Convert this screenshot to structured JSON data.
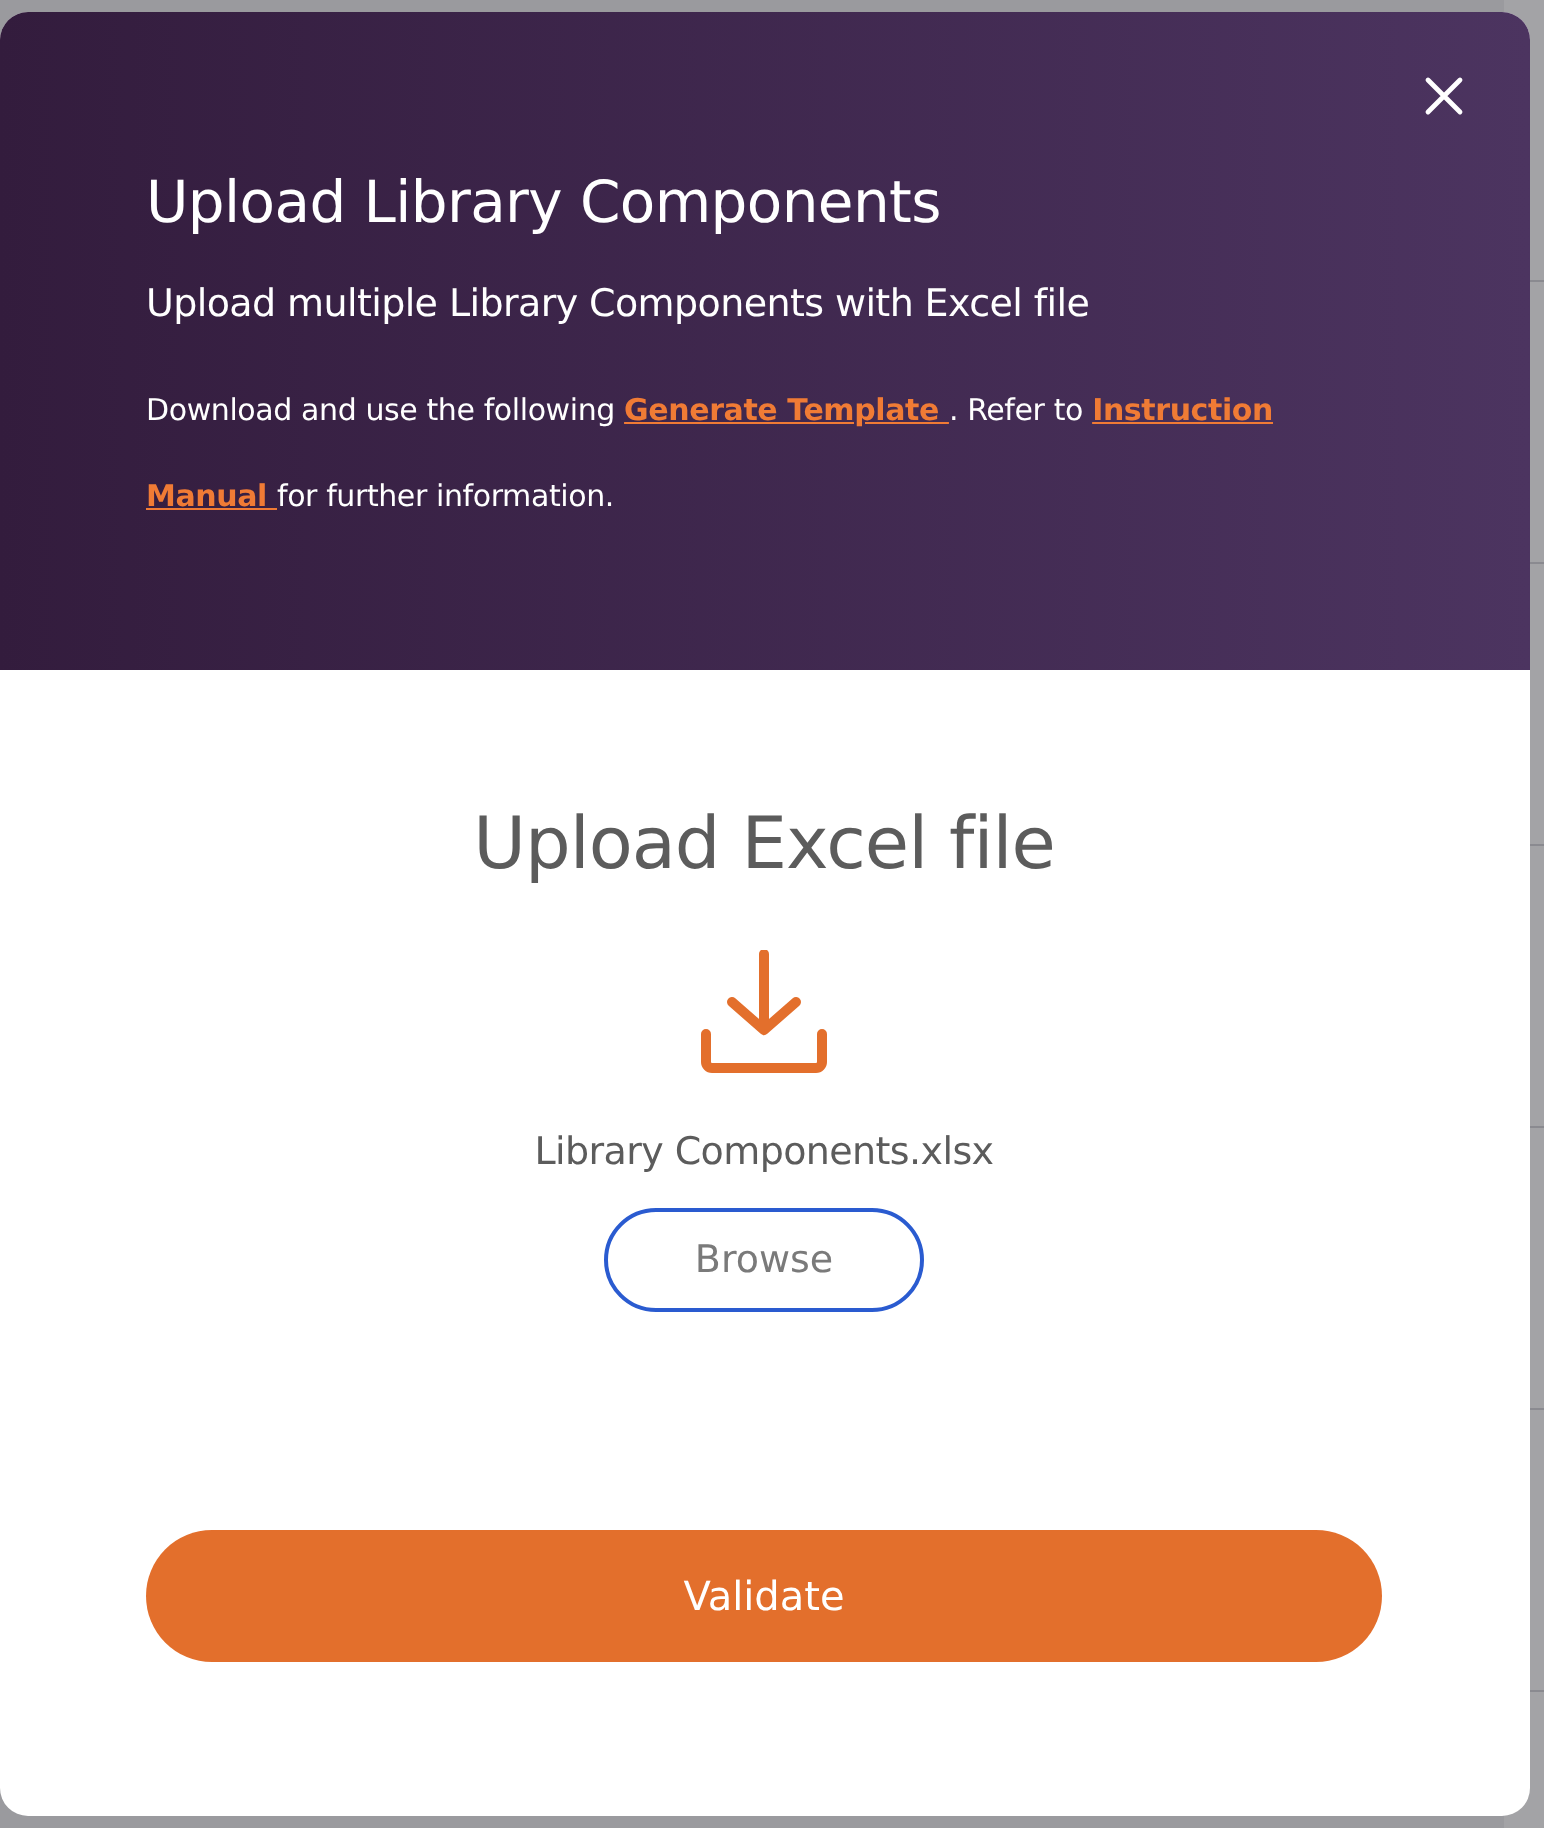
{
  "dialog": {
    "title": "Upload Library Components",
    "subtitle": "Upload multiple Library Components with Excel file",
    "description": [
      {
        "kind": "text",
        "text": "Download and use the following "
      },
      {
        "kind": "link",
        "text": "Generate Template "
      },
      {
        "kind": "text",
        "text": ". Refer to "
      },
      {
        "kind": "link",
        "text": "Instruction"
      },
      {
        "kind": "break"
      },
      {
        "kind": "link",
        "text": "Manual "
      },
      {
        "kind": "text",
        "text": "for further information."
      }
    ],
    "upload": {
      "heading": "Upload Excel file",
      "file_name": "Library Components.xlsx",
      "browse_button": "Browse"
    },
    "validate_button": "Validate"
  }
}
